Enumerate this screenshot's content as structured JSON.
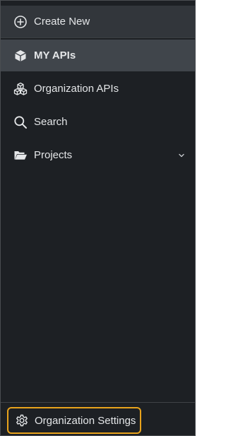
{
  "sidebar": {
    "items": [
      {
        "label": "Create New",
        "icon": "plus-circle-icon"
      },
      {
        "label": "MY APIs",
        "icon": "cube-icon",
        "active": true
      },
      {
        "label": "Organization APIs",
        "icon": "cubes-icon"
      },
      {
        "label": "Search",
        "icon": "search-icon"
      },
      {
        "label": "Projects",
        "icon": "folder-open-icon",
        "expandable": true,
        "expand_icon": "chevron-down-icon"
      }
    ],
    "footer": {
      "label": "Organization Settings",
      "icon": "gear-icon",
      "highlight_color": "#e8a31c"
    }
  },
  "colors": {
    "background": "#1d2024",
    "active_item": "#40454b",
    "text": "#e4e6e8",
    "accent": "#e8a31c"
  }
}
